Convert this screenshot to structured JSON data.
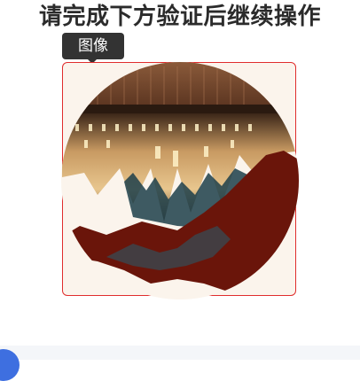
{
  "header": {
    "title": "请完成下方验证后继续操作"
  },
  "tooltip": {
    "label": "图像"
  },
  "captcha": {
    "image_icon": "rotated-building-photo"
  },
  "colors": {
    "frame_border": "#e02d2d",
    "slider_handle": "#3e6fe0",
    "tooltip_bg": "#333333"
  }
}
